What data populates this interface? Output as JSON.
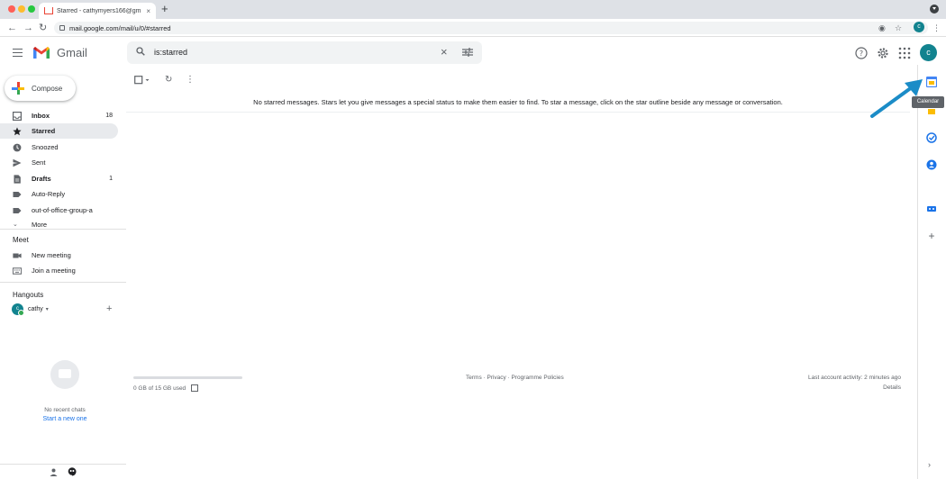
{
  "browser": {
    "tab_title": "Starred - cathymyers166@gm",
    "tab_close": "×",
    "new_tab": "+",
    "url": "mail.google.com/mail/u/0/#starred",
    "avatar_letter": "c"
  },
  "header": {
    "logo_text": "Gmail",
    "search_value": "is:starred",
    "avatar_letter": "c"
  },
  "sidebar": {
    "compose_label": "Compose",
    "items": [
      {
        "label": "Inbox",
        "count": "18"
      },
      {
        "label": "Starred",
        "count": ""
      },
      {
        "label": "Snoozed",
        "count": ""
      },
      {
        "label": "Sent",
        "count": ""
      },
      {
        "label": "Drafts",
        "count": "1"
      },
      {
        "label": "Auto-Reply",
        "count": ""
      },
      {
        "label": "out-of-office-group-a",
        "count": ""
      },
      {
        "label": "More",
        "count": ""
      }
    ],
    "meet": {
      "heading": "Meet",
      "items": [
        "New meeting",
        "Join a meeting"
      ]
    },
    "hangouts": {
      "heading": "Hangouts",
      "user": "cathy",
      "avatar_letter": "c",
      "no_chats": "No recent chats",
      "start_new": "Start a new one"
    }
  },
  "main": {
    "empty_message": "No starred messages. Stars let you give messages a special status to make them easier to find. To star a message, click on the star outline beside any message or conversation.",
    "storage_text": "0 GB of 15 GB used",
    "footer_links": "Terms · Privacy · Programme Policies",
    "last_activity": "Last account activity: 2 minutes ago",
    "details": "Details"
  },
  "side_panel": {
    "tooltip": "Calendar"
  },
  "colors": {
    "accent_blue": "#1a73e8",
    "avatar_teal": "#12838f",
    "annotation_arrow": "#1b8cc7"
  }
}
